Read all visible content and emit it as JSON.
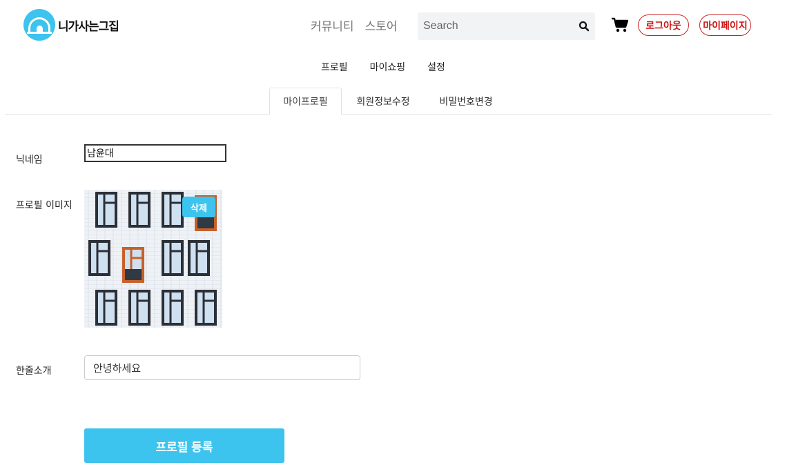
{
  "header": {
    "logo_text": "니가사는그집",
    "nav": [
      "커뮤니티",
      "스토어"
    ],
    "search": {
      "placeholder": "Search",
      "value": ""
    },
    "logout_label": "로그아웃",
    "mypage_label": "마이페이지"
  },
  "sub_nav": [
    "프로필",
    "마이쇼핑",
    "설정"
  ],
  "tabs": [
    "마이프로필",
    "회원정보수정",
    "비밀번호변경"
  ],
  "form": {
    "nickname_label": "닉네임",
    "nickname_value": "남윤대",
    "profile_image_label": "프로필 이미지",
    "delete_label": "삭제",
    "intro_label": "한줄소개",
    "intro_value": "안녕하세요",
    "submit_label": "프로필 등록"
  },
  "colors": {
    "accent": "#3cc3ee",
    "danger": "#cc1111",
    "window_frame": "#2b2f36",
    "window_orange": "#c8602a"
  }
}
